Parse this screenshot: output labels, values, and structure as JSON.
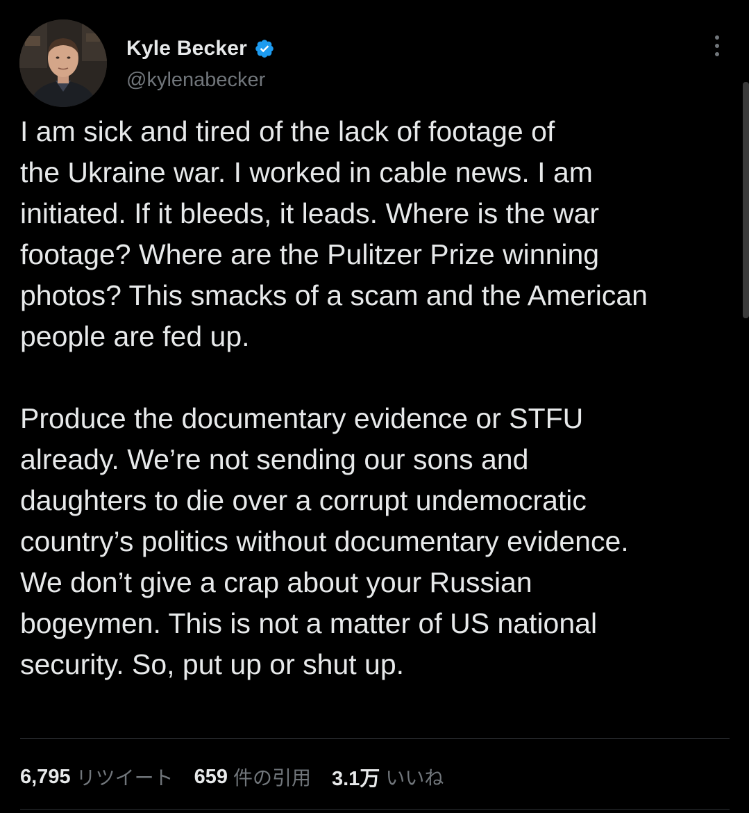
{
  "author": {
    "name": "Kyle Becker",
    "handle": "@kylenabecker",
    "verified": true,
    "avatar_icon": "person-avatar",
    "verified_icon": "verified-badge-icon"
  },
  "menu_icon": "more-vertical-icon",
  "tweet": {
    "paragraph_1": [
      "I am sick and tired of the lack of footage of",
      "the Ukraine war. I worked in cable news. I am",
      "initiated. If it bleeds, it leads. Where is the war",
      "footage? Where are the Pulitzer Prize winning",
      "photos? This smacks of a scam and the American",
      "people are fed up."
    ],
    "paragraph_2": [
      "Produce the documentary evidence or STFU",
      "already. We’re not sending our sons and",
      "daughters to die over a corrupt undemocratic",
      "country’s politics without documentary evidence.",
      "We don’t give a crap about your Russian",
      "bogeymen. This is not a matter of US national",
      "security. So, put up or shut up."
    ]
  },
  "stats": {
    "retweets": {
      "count": "6,795",
      "label": "リツイート"
    },
    "quotes": {
      "count": "659",
      "label": "件の引用"
    },
    "likes": {
      "count": "3.1万",
      "label": "いいね"
    }
  },
  "colors": {
    "background": "#000000",
    "text_primary": "#e7e9ea",
    "text_secondary": "#71767b",
    "verified_blue": "#1d9bf0",
    "divider": "#2f3336"
  }
}
